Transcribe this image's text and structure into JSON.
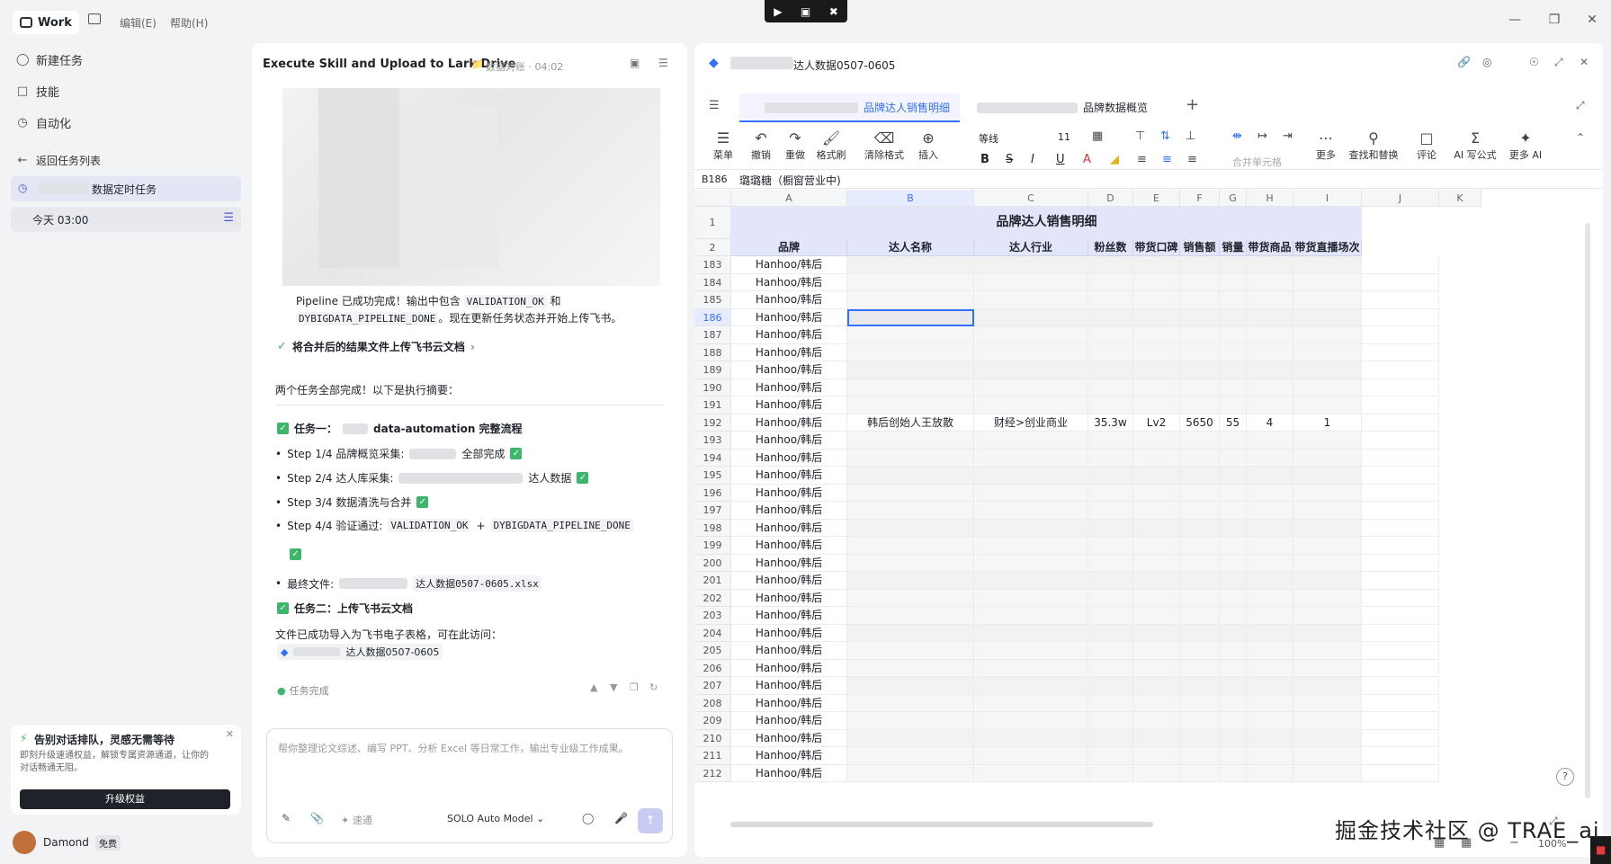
{
  "app": {
    "work_label": "Work",
    "menu_edit": "编辑(E)",
    "menu_help": "帮助(H)"
  },
  "sidebar": {
    "new_task": "新建任务",
    "skills": "技能",
    "automation": "自动化",
    "back_to_list": "返回任务列表",
    "task_name": "数据定时任务",
    "task_time": "今天 03:00",
    "promo_title": "告别对话排队，灵感无需等待",
    "promo_body": "即刻升级速通权益，解锁专属资源通道，让你的对话畅通无阻。",
    "promo_button": "升级权益",
    "user_name": "Damond",
    "user_plan": "免费"
  },
  "chat": {
    "title": "Execute Skill and Upload to Lark Drive",
    "folder": "数据对账 · 04:02",
    "pipeline_pre": "Pipeline 已成功完成！输出中包含",
    "pipeline_code1": "VALIDATION_OK",
    "pipeline_and": "和",
    "pipeline_code2": "DYBIGDATA_PIPELINE_DONE",
    "pipeline_post": "。现在更新任务状态并开始上传飞书。",
    "step_upload": "将合并后的结果文件上传飞书云文档",
    "summary": "两个任务全部完成！以下是执行摘要：",
    "task1_title": "任务一：",
    "task1_suffix": "data-automation 完整流程",
    "step1": "Step 1/4 品牌概览采集:",
    "step1_suffix": "全部完成",
    "step2": "Step 2/4 达人库采集:",
    "step2_suffix": "达人数据",
    "step3": "Step 3/4 数据清洗与合并",
    "step4": "Step 4/4 验证通过:",
    "step4_code1": "VALIDATION_OK",
    "step4_plus": "+",
    "step4_code2": "DYBIGDATA_PIPELINE_DONE",
    "final_file_label": "最终文件:",
    "final_file_name": "达人数据0507-0605.xlsx",
    "task2_title": "任务二：上传飞书云文档",
    "imported_text": "文件已成功导入为飞书电子表格，可在此访问：",
    "link_text": "达人数据0507-0605",
    "task_done": "任务完成",
    "input_placeholder": "帮你整理论文综述、编写 PPT、分析 Excel 等日常工作，输出专业级工作成果。",
    "speed_label": "速通",
    "model_label": "SOLO Auto Model"
  },
  "sheet": {
    "doc_title": "达人数据0507-0605",
    "tab1": "品牌达人销售明细",
    "tab2": "品牌数据概览",
    "toolbar": [
      "菜单",
      "撤销",
      "重做",
      "格式刷",
      "清除格式",
      "插入"
    ],
    "toolbar_right": [
      "更多",
      "查找和替换",
      "评论",
      "AI 写公式",
      "更多 AI"
    ],
    "font_name": "等线",
    "font_size": "11",
    "merge_label": "合并单元格",
    "cell_ref": "B186",
    "cell_value": "璐璐糖（橱窗营业中)",
    "columns": [
      "A",
      "B",
      "C",
      "D",
      "E",
      "F",
      "G",
      "H",
      "I",
      "J",
      "K"
    ],
    "sheet_title": "品牌达人销售明细",
    "headers": [
      "品牌",
      "达人名称",
      "达人行业",
      "粉丝数",
      "带货口碑",
      "销售额",
      "销量",
      "带货商品",
      "带货直播场次"
    ],
    "rows": [
      "183",
      "184",
      "185",
      "186",
      "187",
      "188",
      "189",
      "190",
      "191",
      "192",
      "193",
      "194",
      "195",
      "196",
      "197",
      "198",
      "199",
      "200",
      "201",
      "202",
      "203",
      "204",
      "205",
      "206",
      "207",
      "208",
      "209",
      "210",
      "211",
      "212"
    ],
    "brand_value": "Hanhoo/韩后",
    "row192": [
      "韩后创始人王放散",
      "财经>创业商业",
      "35.3w",
      "Lv2",
      "5650",
      "55",
      "4",
      "1"
    ],
    "zoom": "100%"
  },
  "watermark": "掘金技术社区 @ TRAE_ai"
}
